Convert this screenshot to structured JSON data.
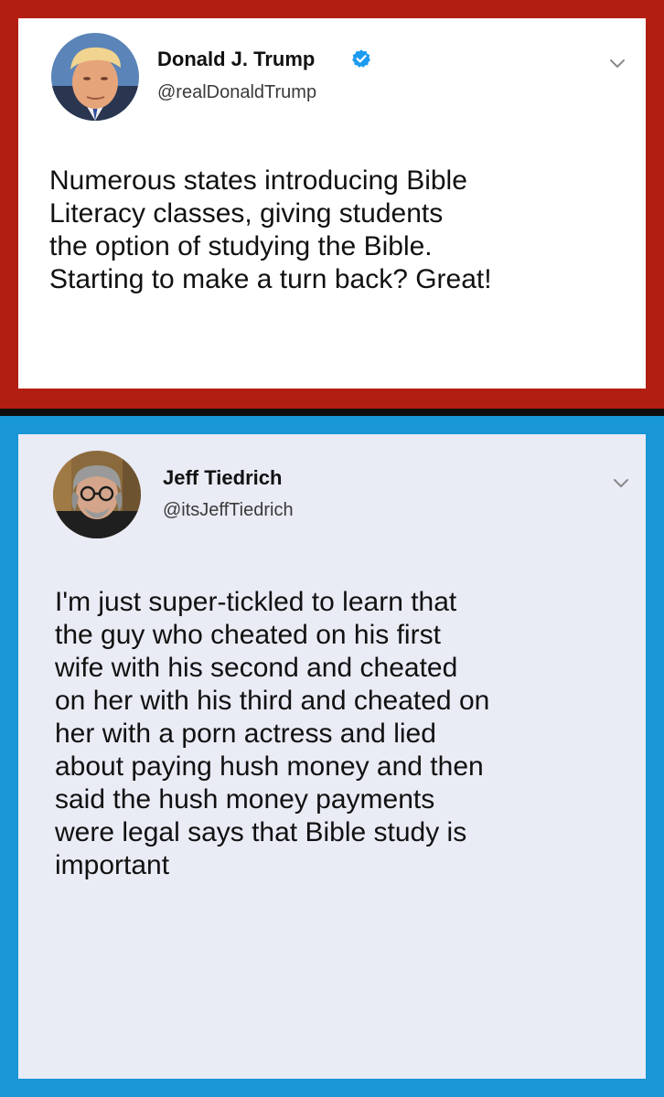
{
  "tweets": [
    {
      "author": {
        "name": "Donald J. Trump",
        "handle": "@realDonaldTrump",
        "verified": true,
        "avatar_icon": "person-avatar-icon"
      },
      "text_lines": [
        "Numerous states introducing Bible",
        "Literacy classes, giving students",
        "the option of studying the Bible.",
        "Starting to make a turn back? Great!"
      ],
      "frame_color": "#b31e12",
      "card_color": "#ffffff"
    },
    {
      "author": {
        "name": "Jeff Tiedrich",
        "handle": "@itsJeffTiedrich",
        "verified": false,
        "avatar_icon": "person-avatar-icon"
      },
      "text_lines": [
        "I'm just super-tickled to learn that",
        "the guy who cheated on his first",
        "wife with his second and cheated",
        "on her with his third and cheated on",
        "her with a porn actress and lied",
        "about paying hush money and then",
        "said the hush money payments",
        "were legal says that Bible study is",
        "important"
      ],
      "frame_color": "#1896d6",
      "card_color": "#e9ebf5"
    }
  ],
  "colors": {
    "verified_badge": "#1d9bf0",
    "background_gap": "#0e0e0e"
  }
}
